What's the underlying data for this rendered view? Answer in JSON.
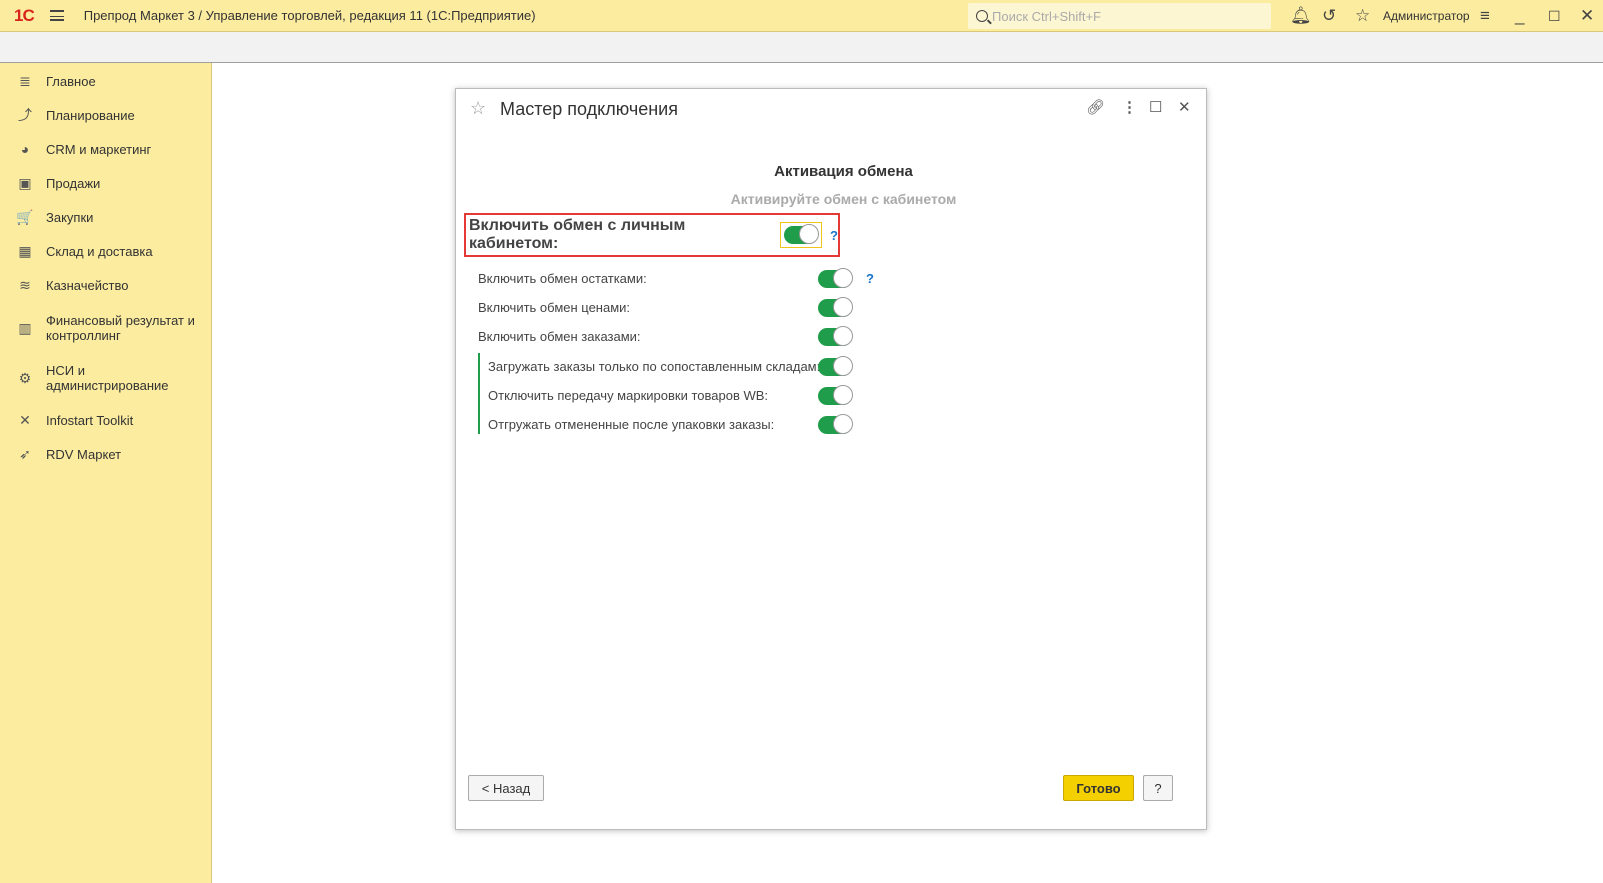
{
  "titlebar": {
    "logo": "1С",
    "title": "Препрод Маркет 3 / Управление торговлей, редакция 11  (1С:Предприятие)",
    "search_placeholder": "Поиск Ctrl+Shift+F",
    "user": "Администратор"
  },
  "sidebar": {
    "items": [
      {
        "label": "Главное",
        "icon": "≣"
      },
      {
        "label": "Планирование",
        "icon": "⤴"
      },
      {
        "label": "CRM и маркетинг",
        "icon": "◕"
      },
      {
        "label": "Продажи",
        "icon": "▣"
      },
      {
        "label": "Закупки",
        "icon": "🛒"
      },
      {
        "label": "Склад и доставка",
        "icon": "▦"
      },
      {
        "label": "Казначейство",
        "icon": "≋"
      },
      {
        "label": "Финансовый результат и контроллинг",
        "icon": "▥"
      },
      {
        "label": "НСИ и администрирование",
        "icon": "⚙"
      },
      {
        "label": "Infostart Toolkit",
        "icon": "✕"
      },
      {
        "label": "RDV Маркет",
        "icon": "➶"
      }
    ]
  },
  "dialog": {
    "title": "Мастер подключения",
    "heading": "Активация обмена",
    "subheading": "Активируйте обмен с кабинетом",
    "main_toggle": {
      "label": "Включить обмен с личным кабинетом:",
      "on": true,
      "help": "?"
    },
    "options": [
      {
        "label": "Включить обмен остатками:",
        "on": true,
        "help": "?"
      },
      {
        "label": "Включить обмен ценами:",
        "on": true
      },
      {
        "label": "Включить обмен заказами:",
        "on": true
      },
      {
        "label": "Загружать заказы только по сопоставленным складам:",
        "on": true
      },
      {
        "label": "Отключить передачу маркировки товаров WB:",
        "on": true
      },
      {
        "label": "Отгружать отмененные после упаковки заказы:",
        "on": true
      }
    ],
    "back": "< Назад",
    "done": "Готово",
    "help": "?"
  },
  "colors": {
    "accent": "#1f9d4a",
    "highlight": "#e53935",
    "sidebar": "#fbeca0"
  }
}
